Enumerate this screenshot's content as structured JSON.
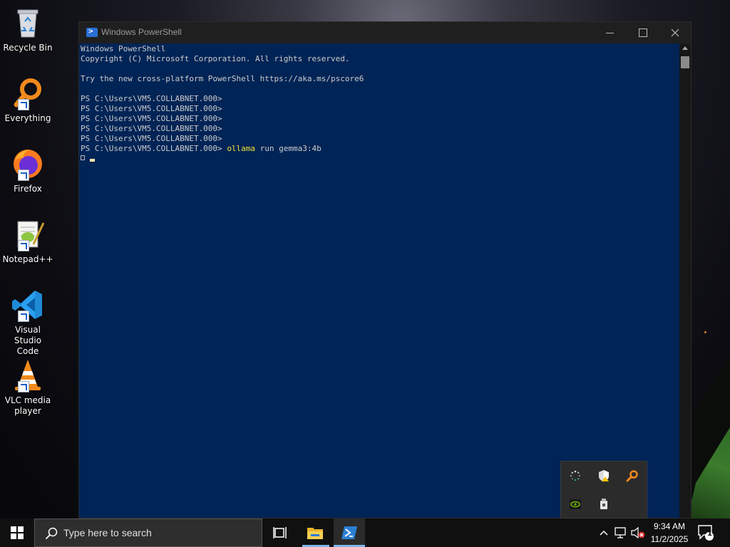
{
  "desktop": {
    "icons": [
      {
        "label": "Recycle Bin",
        "icon": "recycle-bin-icon"
      },
      {
        "label": "Everything",
        "icon": "everything-icon"
      },
      {
        "label": "Firefox",
        "icon": "firefox-icon"
      },
      {
        "label": "Notepad++",
        "icon": "notepad-plus-plus-icon"
      },
      {
        "label": "Visual Studio Code",
        "icon": "vscode-icon"
      },
      {
        "label": "VLC media player",
        "icon": "vlc-icon"
      }
    ]
  },
  "window": {
    "title": "Windows PowerShell",
    "background": "#012456"
  },
  "console": {
    "lines": [
      "Windows PowerShell",
      "Copyright (C) Microsoft Corporation. All rights reserved.",
      "",
      "Try the new cross-platform PowerShell https://aka.ms/pscore6",
      "",
      "PS C:\\Users\\VM5.COLLABNET.000>",
      "PS C:\\Users\\VM5.COLLABNET.000>",
      "PS C:\\Users\\VM5.COLLABNET.000>",
      "PS C:\\Users\\VM5.COLLABNET.000>",
      "PS C:\\Users\\VM5.COLLABNET.000>"
    ],
    "command_prompt": "PS C:\\Users\\VM5.COLLABNET.000> ",
    "command_keyword": "ollama",
    "command_args": " run gemma3:4b"
  },
  "tray_flyout": {
    "icons": [
      "sync-spinner-icon",
      "security-shield-icon",
      "everything-search-icon",
      "nvidia-icon",
      "usb-eject-icon"
    ]
  },
  "taskbar": {
    "search_placeholder": "Type here to search",
    "time": "9:34 AM",
    "date": "11/2/2025",
    "notification_count": "1"
  },
  "colors": {
    "accent": "#7fb4e8",
    "keyword": "#f0e034",
    "console_text": "#cccccc"
  }
}
